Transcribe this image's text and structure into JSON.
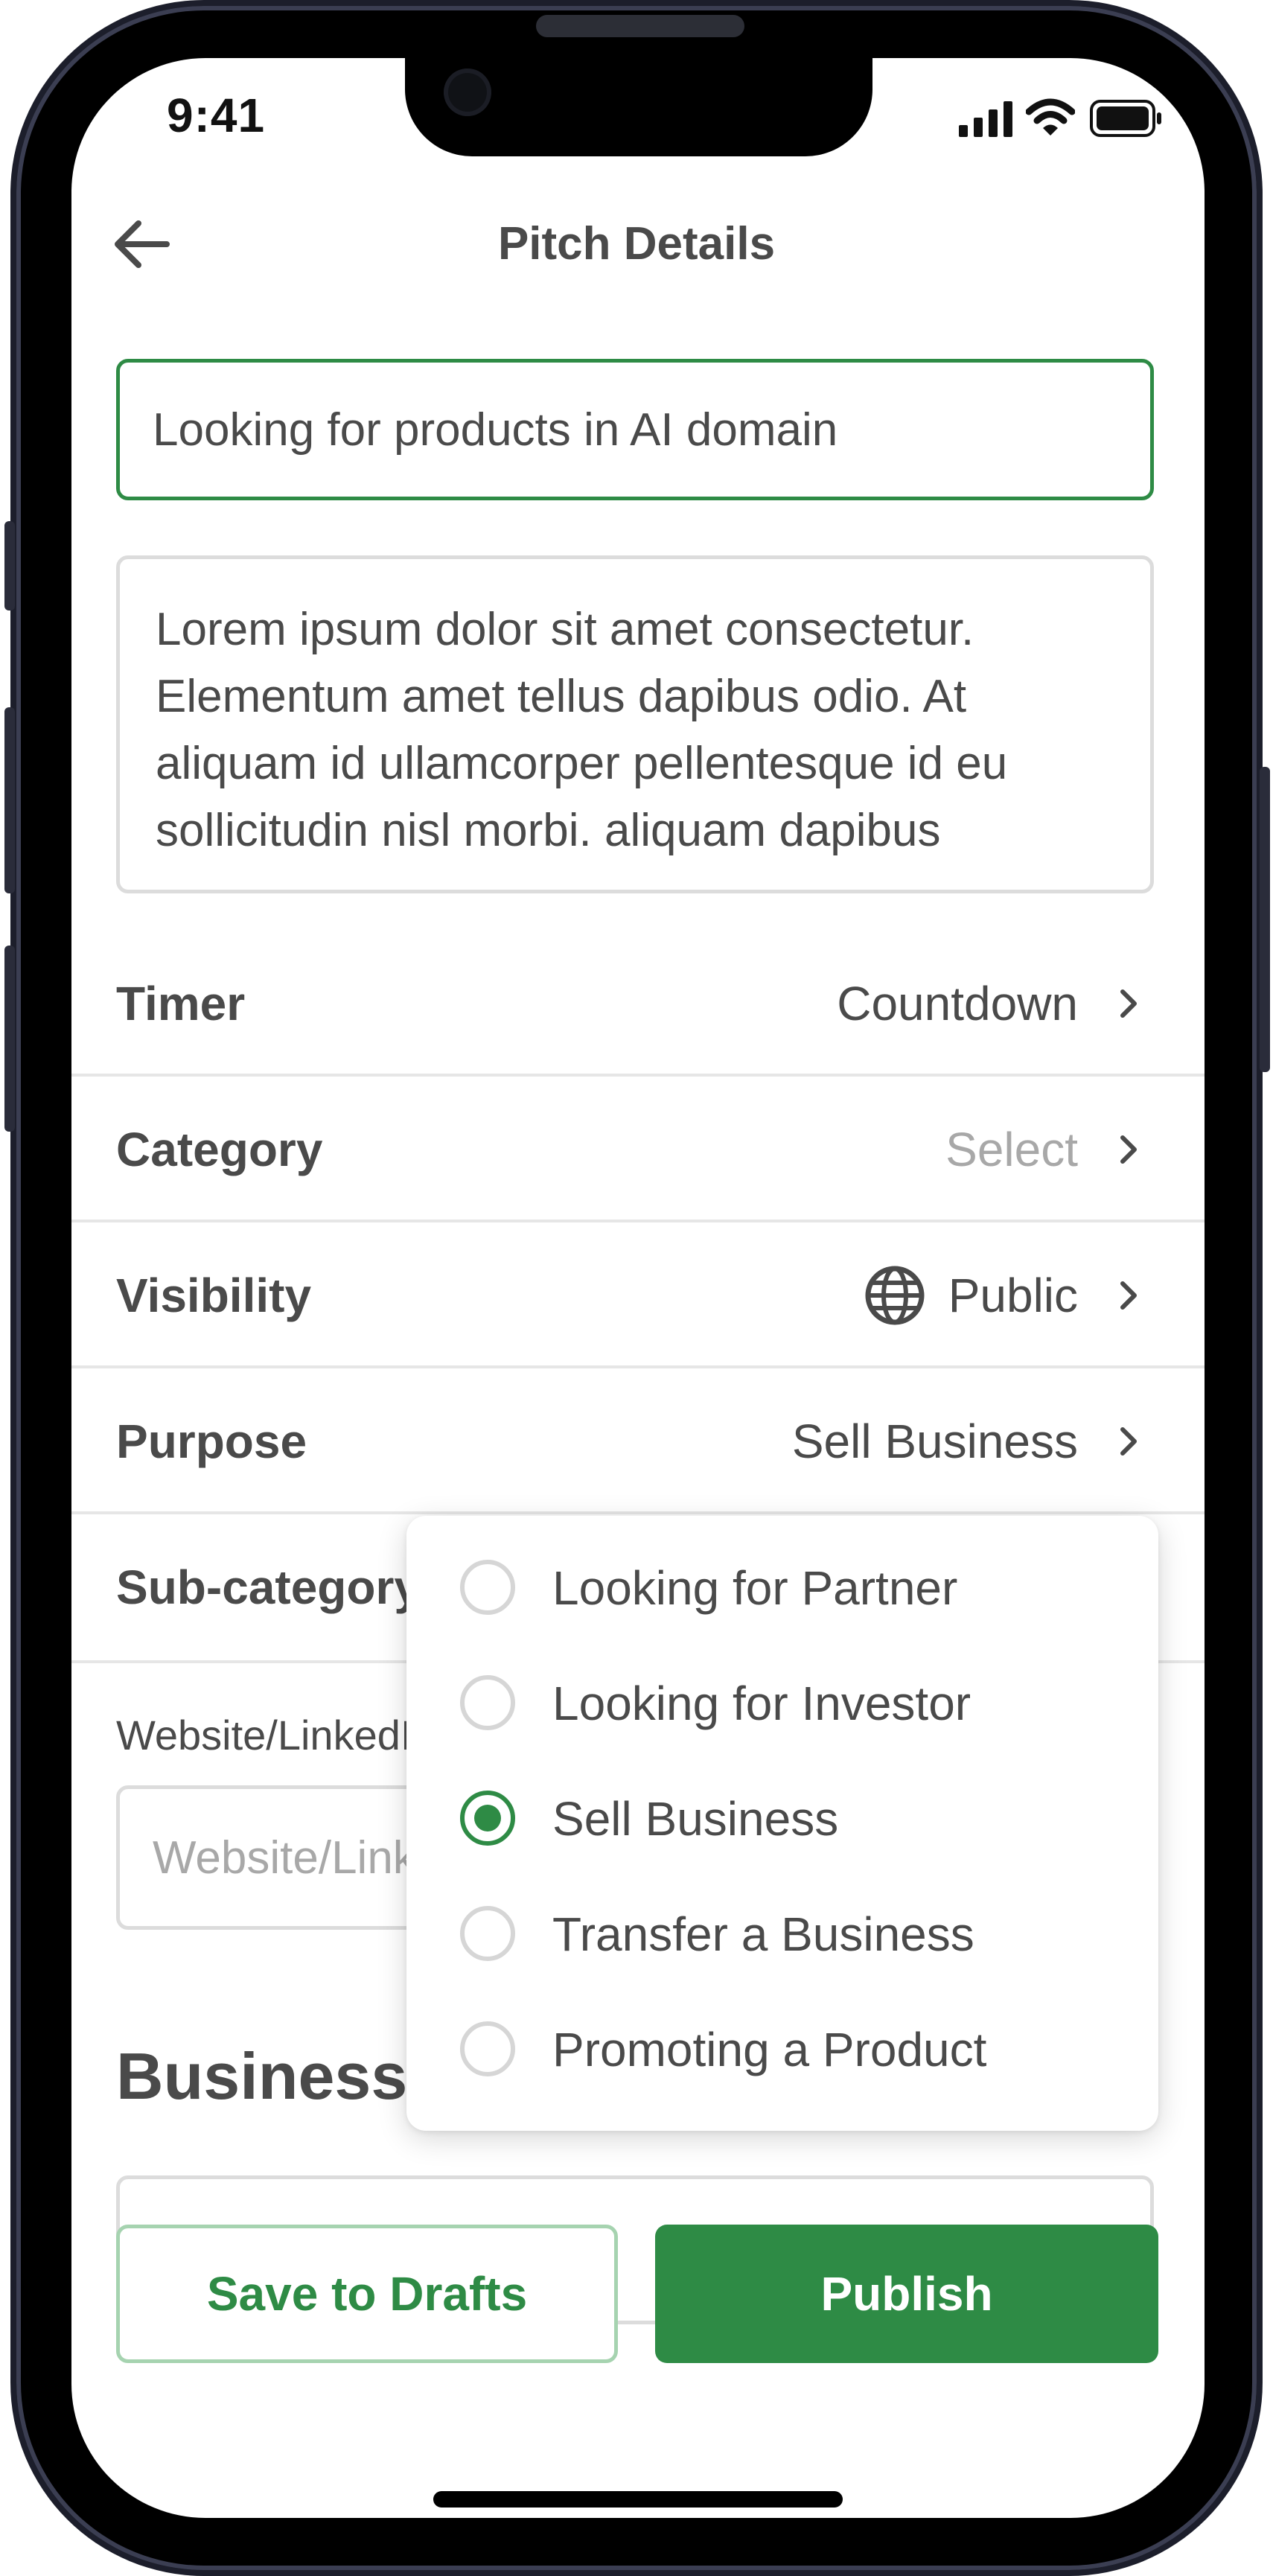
{
  "status_bar": {
    "time": "9:41"
  },
  "header": {
    "title": "Pitch Details"
  },
  "pitch_title": {
    "value": "Looking for products in AI domain"
  },
  "description": {
    "value": "Lorem ipsum dolor sit amet consectetur. Elementum amet tellus dapibus odio. At aliquam id ullamcorper pellentesque id eu sollicitudin nisl morbi. aliquam dapibus"
  },
  "rows": [
    {
      "label": "Timer",
      "value": "Countdown"
    },
    {
      "label": "Category",
      "value": "Select"
    },
    {
      "label": "Visibility",
      "value": "Public"
    },
    {
      "label": "Purpose",
      "value": "Sell Business"
    },
    {
      "label": "Sub-category",
      "value": ""
    }
  ],
  "website": {
    "label": "Website/LinkedIn",
    "placeholder": "Website/LinkedIn"
  },
  "business_section": {
    "title": "Business Details"
  },
  "purpose_dropdown": {
    "options": [
      {
        "label": "Looking for Partner",
        "selected": false
      },
      {
        "label": "Looking for Investor",
        "selected": false
      },
      {
        "label": "Sell Business",
        "selected": true
      },
      {
        "label": "Transfer a Business",
        "selected": false
      },
      {
        "label": "Promoting a Product",
        "selected": false
      }
    ]
  },
  "buttons": {
    "save_drafts": "Save to Drafts",
    "publish": "Publish"
  },
  "colors": {
    "accent": "#2e8b45",
    "text": "#4a4a4a",
    "placeholder": "#a8a8a8",
    "border": "#dcdcdc"
  },
  "icons": {
    "back": "arrow-left-icon",
    "chevron": "chevron-right-icon",
    "globe": "globe-icon",
    "signal": "signal-icon",
    "wifi": "wifi-icon",
    "battery": "battery-icon"
  }
}
